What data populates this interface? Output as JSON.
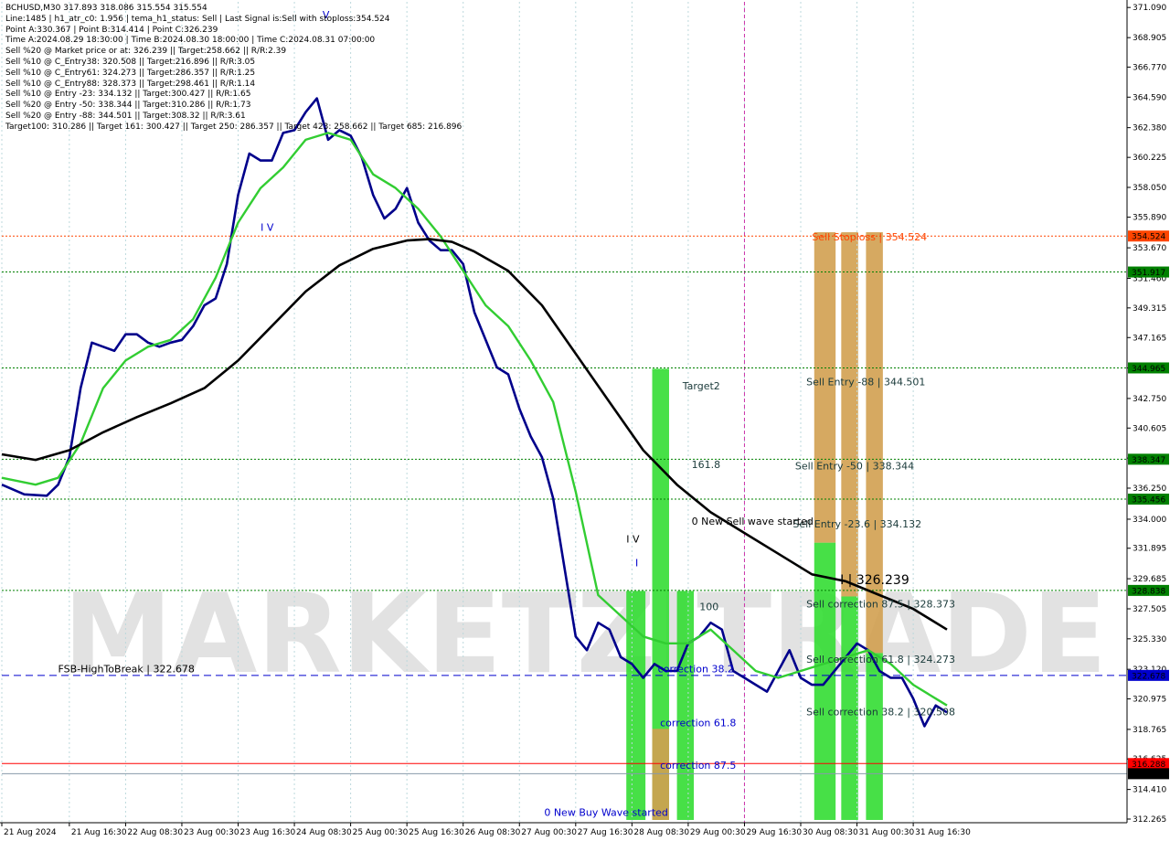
{
  "header": {
    "lines": [
      "BCHUSD,M30  317.893 318.086 315.554 315.554",
      "Line:1485 | h1_atr_c0: 1.956 | tema_h1_status: Sell | Last Signal is:Sell with stoploss:354.524",
      "Point A:330.367 | Point B:314.414 | Point C:326.239",
      "Time A:2024.08.29 18:30:00 | Time B:2024.08.30 18:00:00 | Time C:2024.08.31 07:00:00",
      "Sell %20 @ Market price or at: 326.239 || Target:258.662 || R/R:2.39",
      "Sell %10 @ C_Entry38: 320.508 || Target:216.896 || R/R:3.05",
      "Sell %10 @ C_Entry61: 324.273 || Target:286.357 || R/R:1.25",
      "Sell %10 @ C_Entry88: 328.373 || Target:298.461 || R/R:1.14",
      "Sell %10 @ Entry -23: 334.132 || Target:300.427 || R/R:1.65",
      "Sell %20 @ Entry -50: 338.344 || Target:310.286 || R/R:1.73",
      "Sell %20 @ Entry -88: 344.501 || Target:308.32 || R/R:3.61",
      "Target100: 310.286 || Target 161: 300.427 || Target 250: 286.357 || Target 423: 258.662 || Target 685: 216.896"
    ]
  },
  "watermark": "MARKETZITRADE",
  "colors": {
    "background": "#ffffff",
    "ema_fast": "#00008b",
    "ema_mid": "#32cd32",
    "ema_slow": "#000000",
    "stop_line": "#ff4500",
    "green_level": "#008000",
    "fsb_line": "#0000cd",
    "current_red": "#ff0000",
    "green_bar": "#33dd33",
    "orange_bar": "#d2a050"
  },
  "chart_data": {
    "type": "line",
    "symbol": "BCHUSD",
    "timeframe": "M30",
    "ylim": [
      312.0,
      371.5
    ],
    "y_ticks": [
      "371.090",
      "368.905",
      "366.770",
      "364.590",
      "362.380",
      "360.225",
      "358.050",
      "355.890",
      "353.670",
      "351.460",
      "349.315",
      "347.165",
      "344.965",
      "342.750",
      "340.605",
      "338.430",
      "336.250",
      "334.000",
      "331.895",
      "329.685",
      "327.505",
      "325.330",
      "323.120",
      "320.975",
      "318.765",
      "316.625",
      "314.410",
      "312.265"
    ],
    "x_labels": [
      "21 Aug 2024",
      "21 Aug 16:30",
      "22 Aug 08:30",
      "23 Aug 00:30",
      "23 Aug 16:30",
      "24 Aug 08:30",
      "25 Aug 00:30",
      "25 Aug 16:30",
      "26 Aug 08:30",
      "27 Aug 00:30",
      "27 Aug 16:30",
      "28 Aug 08:30",
      "29 Aug 00:30",
      "29 Aug 16:30",
      "30 Aug 08:30",
      "31 Aug 00:30",
      "31 Aug 16:30"
    ],
    "x_range": [
      0,
      100
    ],
    "x_label_positions": [
      0,
      6,
      11,
      16,
      21,
      26,
      31,
      36,
      41,
      46,
      51,
      56,
      61,
      66,
      71,
      76,
      81
    ],
    "price_levels": [
      {
        "label": "354.524",
        "value": 354.524,
        "color": "#ff4500",
        "style": "dotted"
      },
      {
        "label": "351.917",
        "value": 351.917,
        "color": "#008000",
        "style": "dotted"
      },
      {
        "label": "344.965",
        "value": 344.965,
        "color": "#008000",
        "style": "dotted"
      },
      {
        "label": "338.347",
        "value": 338.347,
        "color": "#008000",
        "style": "dotted"
      },
      {
        "label": "335.456",
        "value": 335.456,
        "color": "#008000",
        "style": "dotted"
      },
      {
        "label": "328.838",
        "value": 328.838,
        "color": "#008000",
        "style": "dotted"
      },
      {
        "label": "322.678",
        "value": 322.678,
        "color": "#0000cd",
        "style": "dashed"
      },
      {
        "label": "316.288",
        "value": 316.288,
        "color": "#ff0000",
        "style": "solid"
      },
      {
        "label": "315.554",
        "value": 315.554,
        "color": "#000000",
        "style": "current"
      }
    ],
    "annotations": [
      {
        "text": "Sell Stoploss | 354.524",
        "x": 72,
        "y": 354.2,
        "color": "#ff4500"
      },
      {
        "text": "Sell Entry -88 | 344.501",
        "x": 71.5,
        "y": 343.7,
        "color": "#1a3a3a"
      },
      {
        "text": "Sell Entry -50 | 338.344",
        "x": 70.5,
        "y": 337.6,
        "color": "#1a3a3a"
      },
      {
        "text": "Sell Entry -23.6 | 334.132",
        "x": 70.3,
        "y": 333.4,
        "color": "#1a3a3a"
      },
      {
        "text": "I | 326.239",
        "x": 74.5,
        "y": 329.3,
        "color": "#000000"
      },
      {
        "text": "Sell correction 87.5 | 328.373",
        "x": 71.5,
        "y": 327.6,
        "color": "#1a3a3a"
      },
      {
        "text": "Sell correction 61.8 | 324.273",
        "x": 71.5,
        "y": 323.6,
        "color": "#1a3a3a"
      },
      {
        "text": "Sell correction 38.2 | 320.508",
        "x": 71.5,
        "y": 319.8,
        "color": "#1a3a3a"
      },
      {
        "text": "Target2",
        "x": 60.5,
        "y": 343.4,
        "color": "#1a3a3a"
      },
      {
        "text": "161.8",
        "x": 61.3,
        "y": 337.7,
        "color": "#1a3a3a"
      },
      {
        "text": "0 New Sell wave started",
        "x": 61.3,
        "y": 333.6,
        "color": "#000000"
      },
      {
        "text": "I V",
        "x": 55.5,
        "y": 332.3,
        "color": "#000000"
      },
      {
        "text": "I",
        "x": 56.3,
        "y": 330.6,
        "color": "#0000cd"
      },
      {
        "text": "100",
        "x": 62,
        "y": 327.4,
        "color": "#1a3a3a"
      },
      {
        "text": "correction 38.2",
        "x": 58.3,
        "y": 322.9,
        "color": "#0000cd"
      },
      {
        "text": "correction 61.8",
        "x": 58.5,
        "y": 319.0,
        "color": "#0000cd"
      },
      {
        "text": "correction 87.5",
        "x": 58.5,
        "y": 315.9,
        "color": "#0000cd"
      },
      {
        "text": "0 New Buy Wave started",
        "x": 48.2,
        "y": 312.5,
        "color": "#0000cd"
      },
      {
        "text": "FSB-HighToBreak | 322.678",
        "x": 5,
        "y": 322.9,
        "color": "#000000"
      },
      {
        "text": "I V",
        "x": 23,
        "y": 354.9,
        "color": "#0000cd"
      },
      {
        "text": "V",
        "x": 28.5,
        "y": 370.3,
        "color": "#0000cd"
      }
    ],
    "bars": [
      {
        "x0": 55.5,
        "x1": 57.2,
        "y0": 312.2,
        "y1": 328.8,
        "color": "#33dd33"
      },
      {
        "x0": 57.8,
        "x1": 59.3,
        "y0": 312.2,
        "y1": 344.9,
        "color": "#33dd33"
      },
      {
        "x0": 57.8,
        "x1": 59.3,
        "y0": 312.2,
        "y1": 318.8,
        "color": "#d2a050"
      },
      {
        "x0": 60.0,
        "x1": 61.5,
        "y0": 312.2,
        "y1": 328.8,
        "color": "#33dd33"
      },
      {
        "x0": 72.2,
        "x1": 74.1,
        "y0": 312.2,
        "y1": 332.3,
        "color": "#33dd33"
      },
      {
        "x0": 72.2,
        "x1": 74.1,
        "y0": 332.3,
        "y1": 354.8,
        "color": "#d2a050"
      },
      {
        "x0": 74.6,
        "x1": 76.1,
        "y0": 312.2,
        "y1": 328.4,
        "color": "#33dd33"
      },
      {
        "x0": 74.6,
        "x1": 76.1,
        "y0": 328.4,
        "y1": 354.8,
        "color": "#d2a050"
      },
      {
        "x0": 76.8,
        "x1": 78.3,
        "y0": 312.2,
        "y1": 324.3,
        "color": "#33dd33"
      },
      {
        "x0": 76.8,
        "x1": 78.3,
        "y0": 324.3,
        "y1": 354.8,
        "color": "#d2a050"
      }
    ],
    "series": [
      {
        "name": "",
        "color": "#00008b",
        "x": [
          0,
          2,
          4,
          5,
          6,
          7,
          8,
          9,
          10,
          11,
          12,
          13,
          14,
          15,
          16,
          17,
          18,
          19,
          20,
          21,
          22,
          23,
          24,
          25,
          26,
          27,
          28,
          29,
          30,
          31,
          32,
          33,
          34,
          35,
          36,
          37,
          38,
          39,
          40,
          41,
          42,
          43,
          44,
          45,
          46,
          47,
          48,
          49,
          50,
          51,
          52,
          53,
          54,
          55,
          56,
          57,
          58,
          59,
          60,
          61,
          62,
          63,
          64,
          65,
          66,
          67,
          68,
          69,
          70,
          71,
          72,
          73,
          74,
          75,
          76,
          77,
          78,
          79,
          80,
          81,
          82,
          83,
          84
        ],
        "y": [
          336.5,
          335.8,
          335.7,
          336.5,
          338.5,
          343.5,
          346.8,
          346.5,
          346.2,
          347.4,
          347.4,
          346.8,
          346.5,
          346.8,
          347.0,
          348.0,
          349.5,
          350.0,
          352.5,
          357.5,
          360.5,
          360.0,
          360.0,
          362.0,
          362.2,
          363.5,
          364.5,
          361.5,
          362.2,
          361.8,
          360.2,
          357.5,
          355.8,
          356.5,
          358.0,
          355.5,
          354.2,
          353.5,
          353.5,
          352.5,
          349.0,
          347.0,
          345.0,
          344.5,
          342.0,
          340.0,
          338.5,
          335.5,
          330.5,
          325.5,
          324.5,
          326.5,
          326.0,
          324.0,
          323.5,
          322.5,
          323.5,
          323.0,
          323.0,
          325.0,
          325.5,
          326.5,
          326.0,
          323.0,
          322.5,
          322.0,
          321.5,
          323.0,
          324.5,
          322.5,
          322.0,
          322.0,
          323.0,
          324.0,
          325.0,
          324.5,
          323.0,
          322.5,
          322.5,
          321.0,
          319.0,
          320.5,
          320.0
        ]
      },
      {
        "name": "",
        "color": "#32cd32",
        "x": [
          0,
          3,
          5,
          7,
          9,
          11,
          13,
          15,
          17,
          19,
          21,
          23,
          25,
          27,
          29,
          31,
          33,
          35,
          37,
          39,
          41,
          43,
          45,
          47,
          49,
          51,
          53,
          55,
          57,
          59,
          61,
          63,
          65,
          67,
          69,
          71,
          73,
          75,
          77,
          79,
          81,
          83,
          84
        ],
        "y": [
          337.0,
          336.5,
          337.0,
          339.5,
          343.5,
          345.5,
          346.5,
          347.0,
          348.5,
          351.5,
          355.5,
          358.0,
          359.5,
          361.5,
          362.0,
          361.5,
          359.0,
          358.0,
          356.5,
          354.5,
          352.0,
          349.5,
          348.0,
          345.5,
          342.5,
          336.0,
          328.5,
          327.0,
          325.5,
          325.0,
          325.0,
          326.0,
          324.5,
          323.0,
          322.5,
          323.0,
          323.5,
          324.0,
          324.5,
          323.5,
          322.0,
          321.0,
          320.5
        ]
      },
      {
        "name": "",
        "color": "#000000",
        "x": [
          0,
          3,
          6,
          9,
          12,
          15,
          18,
          21,
          24,
          27,
          30,
          33,
          36,
          38,
          40,
          42,
          45,
          48,
          51,
          54,
          57,
          60,
          63,
          66,
          69,
          72,
          75,
          78,
          81,
          84
        ],
        "y": [
          338.7,
          338.3,
          339.0,
          340.3,
          341.4,
          342.4,
          343.5,
          345.5,
          348.0,
          350.5,
          352.4,
          353.6,
          354.2,
          354.3,
          354.1,
          353.4,
          352.0,
          349.5,
          346.0,
          342.5,
          339.0,
          336.5,
          334.5,
          333.0,
          331.5,
          330.0,
          329.5,
          328.5,
          327.5,
          326.0
        ]
      }
    ]
  }
}
